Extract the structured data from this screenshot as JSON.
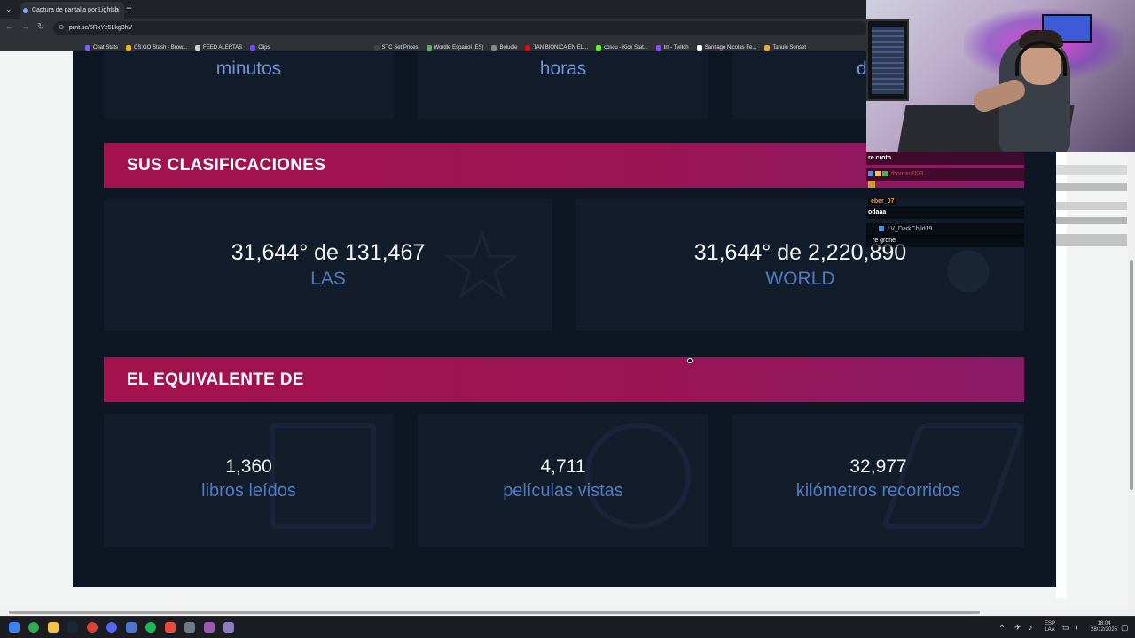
{
  "browser": {
    "tab_title": "Captura de pantalla por Lightsh",
    "tab_close": "×",
    "new_tab": "+",
    "url": "prnt.sc/5RxYz5Lkg3hV",
    "bookmarks": [
      {
        "label": "",
        "color": "#2ea44f"
      },
      {
        "label": "",
        "color": "#ffffff"
      },
      {
        "label": "",
        "color": "#ff6b35"
      },
      {
        "label": "",
        "color": "#ff0000"
      },
      {
        "label": "",
        "color": "#b44aff"
      },
      {
        "label": "Chat Stats",
        "color": "#7b61ff"
      },
      {
        "label": "CS:GO Stash - Brow...",
        "color": "#f5b400"
      },
      {
        "label": "FEED ALERTAS",
        "color": "#d0d0d0"
      },
      {
        "label": "Clips",
        "color": "#6f4cff"
      },
      {
        "label": "",
        "color": "#3fb950"
      },
      {
        "label": "",
        "color": "#5865f2"
      },
      {
        "label": "",
        "color": "#26a269"
      },
      {
        "label": "",
        "color": "#1da1f2"
      },
      {
        "label": "",
        "color": "#f0b90b"
      },
      {
        "label": "",
        "color": "#ff5722"
      },
      {
        "label": "STC Set Prices",
        "color": "#444444"
      },
      {
        "label": "Wordle Español (ES)",
        "color": "#6aaa64"
      },
      {
        "label": "Boludle",
        "color": "#888888"
      },
      {
        "label": "TAN BIONICA EN EL...",
        "color": "#ff0000"
      },
      {
        "label": "coscu - Kick Stat...",
        "color": "#53fc18"
      },
      {
        "label": "trr - Twitch",
        "color": "#9146ff"
      },
      {
        "label": "Santiago Nicolas Fe...",
        "color": "#ffffff"
      },
      {
        "label": "Tanuki Sunset",
        "color": "#f5a623"
      }
    ]
  },
  "page": {
    "top_stats": [
      {
        "label": "minutos"
      },
      {
        "label": "horas"
      },
      {
        "label": "d"
      }
    ],
    "rankings": {
      "title": "SUS CLASIFICACIONES",
      "items": [
        {
          "value": "31,644° de 131,467",
          "label": "LAS"
        },
        {
          "value": "31,644° de 2,220,890",
          "label": "WORLD"
        }
      ]
    },
    "equivalent": {
      "title": "EL EQUIVALENTE DE",
      "items": [
        {
          "value": "1,360",
          "label": "libros leídos"
        },
        {
          "value": "4,711",
          "label": "películas vistas"
        },
        {
          "value": "32,977",
          "label": "kilómetros recorridos"
        }
      ]
    }
  },
  "chat": {
    "messages": [
      {
        "user": "",
        "text": "re croto"
      },
      {
        "user": "thomas1f23",
        "text": ""
      },
      {
        "user": "eber_07",
        "text": "odaaa"
      },
      {
        "user": "LV_DarkChild19",
        "text": "re grone"
      }
    ]
  },
  "taskbar": {
    "language": "ESP",
    "layout": "LAA",
    "time": "18:04",
    "date": "28/12/2025"
  }
}
